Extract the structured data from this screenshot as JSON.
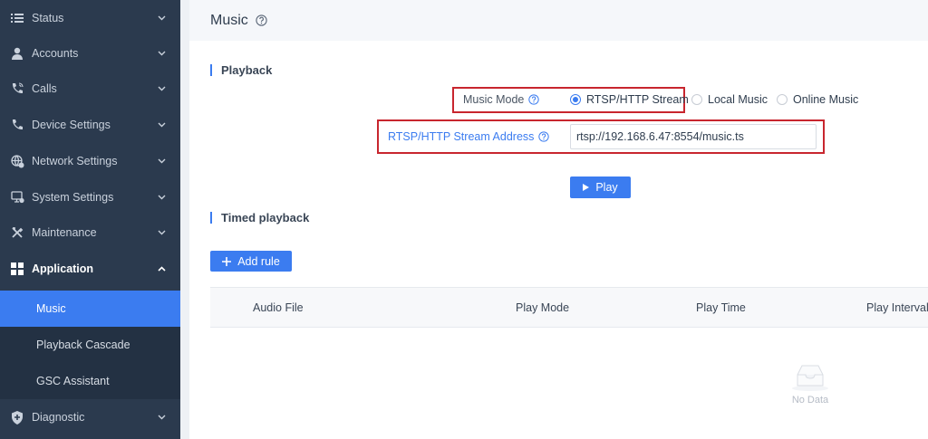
{
  "sidebar": {
    "items": [
      {
        "label": "Status",
        "icon": "list-icon"
      },
      {
        "label": "Accounts",
        "icon": "user-icon"
      },
      {
        "label": "Calls",
        "icon": "phone-call-icon"
      },
      {
        "label": "Device Settings",
        "icon": "phone-icon"
      },
      {
        "label": "Network Settings",
        "icon": "globe-gear-icon"
      },
      {
        "label": "System Settings",
        "icon": "monitor-gear-icon"
      },
      {
        "label": "Maintenance",
        "icon": "tools-icon"
      },
      {
        "label": "Application",
        "icon": "grid-icon"
      },
      {
        "label": "Diagnostic",
        "icon": "shield-icon"
      }
    ],
    "subitems": [
      {
        "label": "Music"
      },
      {
        "label": "Playback Cascade"
      },
      {
        "label": "GSC Assistant"
      }
    ],
    "active_subitem": "Music"
  },
  "header": {
    "title": "Music"
  },
  "playback": {
    "section_title": "Playback",
    "music_mode_label": "Music Mode",
    "options": [
      "RTSP/HTTP Stream",
      "Local Music",
      "Online Music"
    ],
    "selected_option": "RTSP/HTTP Stream",
    "stream_address_label": "RTSP/HTTP Stream Address",
    "stream_address_value": "rtsp://192.168.6.47:8554/music.ts",
    "play_label": "Play"
  },
  "timed": {
    "section_title": "Timed playback",
    "add_rule_label": "Add rule",
    "columns": [
      "Audio File",
      "Play Mode",
      "Play Time",
      "Play Interval"
    ],
    "empty_text": "No Data"
  },
  "colors": {
    "accent": "#3b7cf0",
    "highlight": "#c8262e",
    "sidebar": "#2b3a4e"
  }
}
